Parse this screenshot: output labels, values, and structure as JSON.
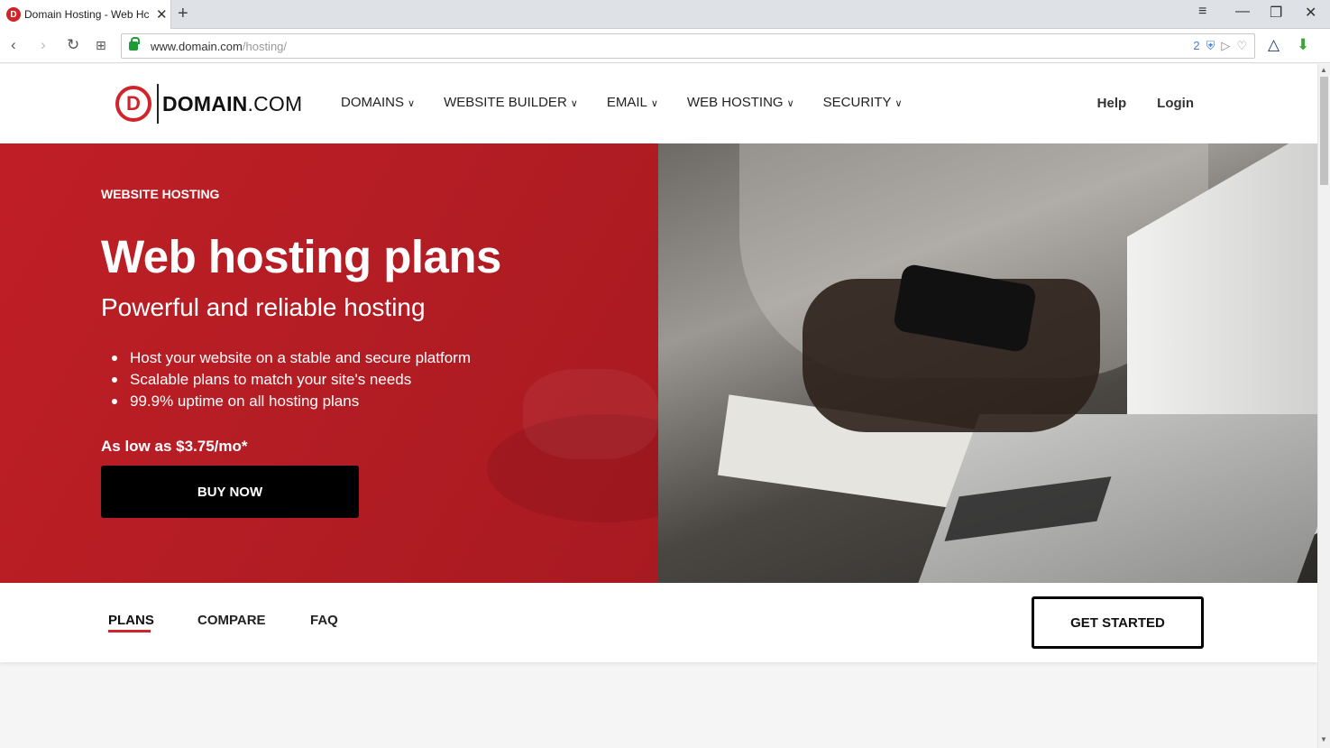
{
  "browser": {
    "tab_title": "Domain Hosting - Web Hc",
    "tab_favicon_letter": "D",
    "new_tab": "+",
    "url_host": "www.domain.com",
    "url_path": "/hosting/",
    "badge_count": "2",
    "window_controls": [
      "minimize",
      "restore",
      "close"
    ]
  },
  "header": {
    "logo_mark": "D",
    "logo_bold": "DOMAIN",
    "logo_suffix": ".COM",
    "nav": [
      {
        "label": "DOMAINS"
      },
      {
        "label": "WEBSITE BUILDER"
      },
      {
        "label": "EMAIL"
      },
      {
        "label": "WEB HOSTING"
      },
      {
        "label": "SECURITY"
      }
    ],
    "help": "Help",
    "login": "Login"
  },
  "hero": {
    "eyebrow": "WEBSITE HOSTING",
    "title": "Web hosting plans",
    "subtitle": "Powerful and reliable hosting",
    "bullets": [
      "Host your website on a stable and secure platform",
      "Scalable plans to match your site's needs",
      "99.9% uptime on all hosting plans"
    ],
    "price": "As low as $3.75/mo*",
    "cta": "BUY NOW"
  },
  "subnav": {
    "tabs": [
      {
        "label": "PLANS",
        "active": true
      },
      {
        "label": "COMPARE"
      },
      {
        "label": "FAQ"
      }
    ],
    "cta": "GET STARTED"
  },
  "colors": {
    "brand_red": "#d1232a",
    "hero_red": "#b51d24",
    "black": "#000000"
  }
}
